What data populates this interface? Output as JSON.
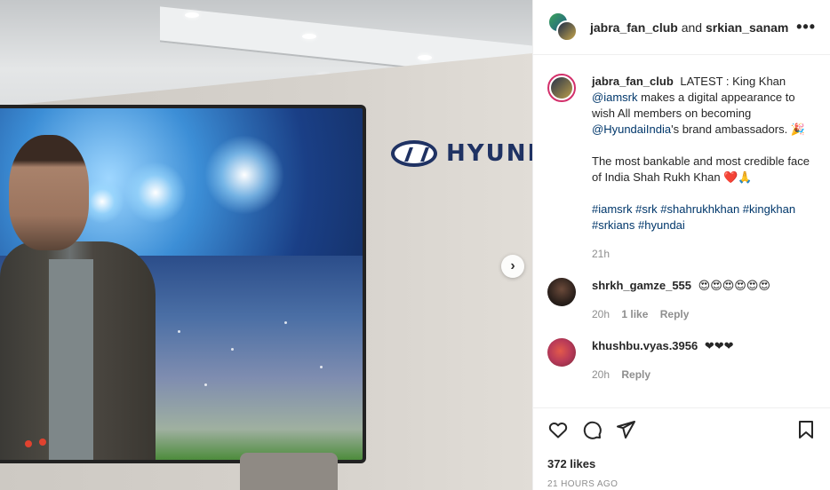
{
  "header": {
    "user1": "jabra_fan_club",
    "and": "and",
    "user2": "srkian_sanam",
    "more_icon": "more-horizontal-icon"
  },
  "caption": {
    "username": "jabra_fan_club",
    "line1": "LATEST : King Khan",
    "mention1": "@iamsrk",
    "line2": "makes a digital appearance to wish All members on becoming",
    "mention2": "@HyundaiIndia",
    "line3": "'s brand ambassadors. 🎉",
    "para2": "The most bankable and most credible face of India Shah Rukh Khan ❤️🙏",
    "hashtags": "#iamsrk #srk #shahrukhkhan #kingkhan #srkians #hyundai",
    "time": "21h"
  },
  "comments": [
    {
      "username": "shrkh_gamze_555",
      "text": "😍😍😍😍😍😍",
      "time": "20h",
      "likes": "1 like",
      "reply": "Reply"
    },
    {
      "username": "khushbu.vyas.3956",
      "text": "❤❤❤",
      "time": "20h",
      "reply": "Reply"
    }
  ],
  "media": {
    "brand_text": "HYUNDAI",
    "next_icon": "chevron-right-icon",
    "next_glyph": "›"
  },
  "actions": {
    "like_icon": "heart-icon",
    "comment_icon": "comment-icon",
    "share_icon": "paper-plane-icon",
    "save_icon": "bookmark-icon",
    "likes": "372 likes",
    "ago": "21 HOURS AGO"
  },
  "colors": {
    "link": "#00376b",
    "meta": "#8e8e8e",
    "text": "#262626",
    "story_ring": "#d3306b"
  }
}
